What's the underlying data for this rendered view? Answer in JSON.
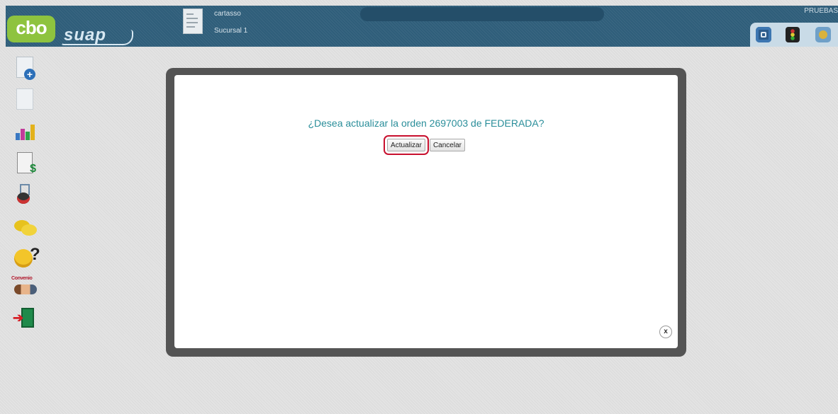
{
  "header": {
    "logo_text": "cbo",
    "brand_text": "suap",
    "user": "cartasso",
    "branch": "Sucursal 1",
    "environment": "PRUEBAS",
    "tray_icons": [
      "window-icon",
      "traffic-light-icon",
      "profile-icon"
    ]
  },
  "sidebar": {
    "items": [
      {
        "icon": "new-document-icon"
      },
      {
        "icon": "document-icon"
      },
      {
        "icon": "bar-chart-icon"
      },
      {
        "icon": "invoice-icon"
      },
      {
        "icon": "lab-flask-icon"
      },
      {
        "icon": "chat-icon"
      },
      {
        "icon": "help-icon"
      },
      {
        "icon": "convenio-icon",
        "label": "Convenio"
      },
      {
        "icon": "exit-icon"
      }
    ]
  },
  "dialog": {
    "message": "¿Desea actualizar la orden 2697003 de FEDERADA?",
    "confirm_label": "Actualizar",
    "cancel_label": "Cancelar",
    "close_label": "x"
  },
  "colors": {
    "header_bg": "#2f5e7a",
    "logo_green": "#8ec33f",
    "message_text": "#2a8e9a",
    "highlight": "#c8102e",
    "overlay_frame": "#545454"
  }
}
